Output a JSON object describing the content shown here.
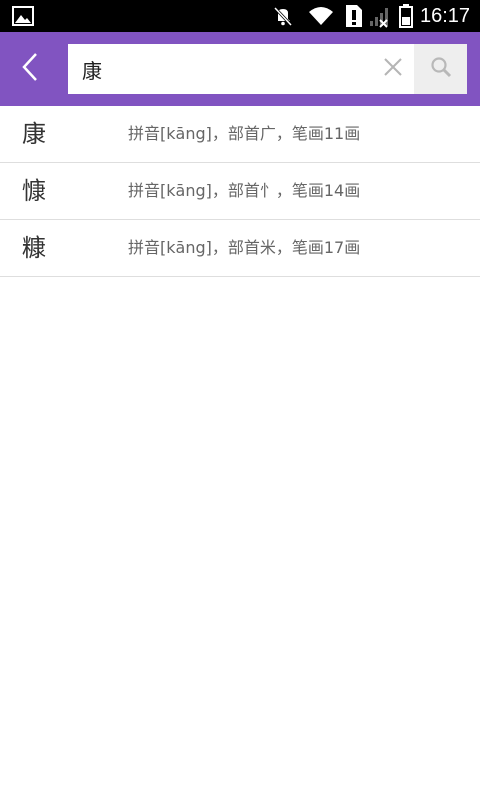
{
  "status_bar": {
    "time": "16:17",
    "icons": [
      "gallery-icon",
      "mute-icon",
      "wifi-icon",
      "sim-alert-icon",
      "signal-icon",
      "battery-icon"
    ]
  },
  "header": {
    "back_icon": "chevron-left-icon",
    "search": {
      "value": "康",
      "placeholder": ""
    },
    "clear_icon": "close-icon",
    "search_icon": "magnifier-icon"
  },
  "results": [
    {
      "char": "康",
      "info": "拼音[kāng]，部首广，笔画11画"
    },
    {
      "char": "慷",
      "info": "拼音[kāng]，部首忄，笔画14画"
    },
    {
      "char": "糠",
      "info": "拼音[kāng]，部首米，笔画17画"
    }
  ],
  "colors": {
    "accent": "#8154c1",
    "status_bar": "#000000",
    "divider": "#dedede",
    "search_button_bg": "#eeeeee"
  }
}
